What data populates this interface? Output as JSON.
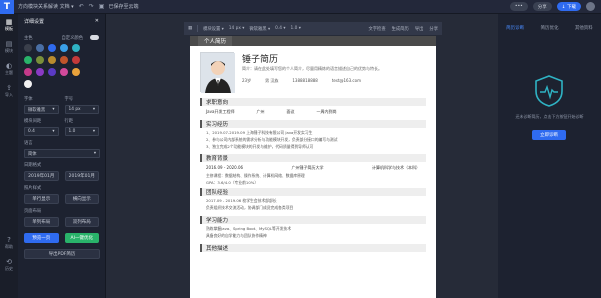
{
  "topbar": {
    "title": "方向模块关系解读 文档 ▾",
    "save_label": "已保存至云端",
    "more_label": "•••",
    "share_label": "分享",
    "download_label": "↓ 下载"
  },
  "leftnav": [
    {
      "icon": "template-icon",
      "label": "模板"
    },
    {
      "icon": "module-icon",
      "label": "模块"
    },
    {
      "icon": "theme-icon",
      "label": "主题"
    },
    {
      "icon": "import-icon",
      "label": "导入"
    },
    {
      "icon": "help-icon",
      "label": "帮助"
    },
    {
      "icon": "history-icon",
      "label": "历史"
    }
  ],
  "panel": {
    "title": "详细设置",
    "theme_label": "主色",
    "custom_label": "自定义颜色",
    "font_label": "字体",
    "font_value": "微软雅黑",
    "size_label": "字号",
    "size_value": "14 px",
    "padding_label": "模块间距",
    "padding_value": "0.4",
    "line_label": "行距",
    "line_value": "1.0",
    "lang_label": "语言",
    "lang_value": "简体",
    "date_label": "日期格式",
    "date_a": "2019年01月",
    "date_b": "2019年01月",
    "photo_label": "照片样式",
    "photo_a": "单行显示",
    "photo_b": "横向显示",
    "layout_label": "页面布局",
    "layout_a": "单列布局",
    "layout_b": "双列布局",
    "btn_preview": "预览一页",
    "btn_ai": "AI一键优化",
    "btn_bottom": "导出PDF简历",
    "swatches": [
      "#3a3f4b",
      "#4a6fa5",
      "#2f6bf0",
      "#3aa0e8",
      "#2fb3c4",
      "#29b36a",
      "#7a8f3a",
      "#b98b2e",
      "#c0552b",
      "#c43a3a",
      "#c43a8a",
      "#8a3ac4",
      "#5a3ac4",
      "#d24a9b",
      "#e9a23b",
      "#f2f2f2"
    ]
  },
  "canvas": {
    "toolbar": [
      "模块设置 ▾",
      "14 px ▾",
      "微软雅黑 ▾",
      "0.4 ▾",
      "1.0 ▾"
    ],
    "toolbar_right": [
      "文字检查",
      "生成简历",
      "导出",
      "分享"
    ]
  },
  "resume": {
    "header_tab": "个人简历",
    "name": "锤子简历",
    "intro": "简介：请在此处填写您的个人简介，尽量用精炼的语言描述自己的优势与特长。",
    "infos": [
      "23岁",
      "男 汉族",
      "1388818888",
      "test@163.com"
    ],
    "sec1_title": "求职意向",
    "sec1_items": [
      "Java开发工程师",
      "广州",
      "面议",
      "一周内到岗"
    ],
    "sec2_title": "实习经历",
    "sec2_lines": [
      "1、2019.07-2019.09 上海锤子科技有限公司 Java开发实习生",
      "2、参与公司内部系统的需求分析与功能模块开发，负责部分接口的编写与测试",
      "3、独立完成2个功能模块的开发与维护，代码质量得到导师认可"
    ],
    "sec3_title": "教育背景",
    "sec3_cols": [
      "2016.09 - 2020.06",
      "广州锤子简历大学",
      "计算机科学与技术（本科）"
    ],
    "sec3_lines": [
      "主修课程：数据结构、操作系统、计算机网络、数据库原理",
      "GPA：3.6/4.0（专业前10%）"
    ],
    "sec4_title": "团队经验",
    "sec4_lines": [
      "2017.09 - 2019.06 校学生会技术部部长",
      "负责组织技术交流活动，协调部门成员完成各类项目"
    ],
    "sec5_title": "学习能力",
    "sec5_lines": [
      "熟练掌握Java、Spring Boot、MySQL等开发技术",
      "具备良好的自学能力与团队协作精神"
    ],
    "sec6_title": "其他描述"
  },
  "rightp": {
    "tabs": [
      "简历诊断",
      "简历优化",
      "其他资料"
    ],
    "text": "还未诊断简历，点击下方按钮开始诊断",
    "button": "立即诊断"
  }
}
